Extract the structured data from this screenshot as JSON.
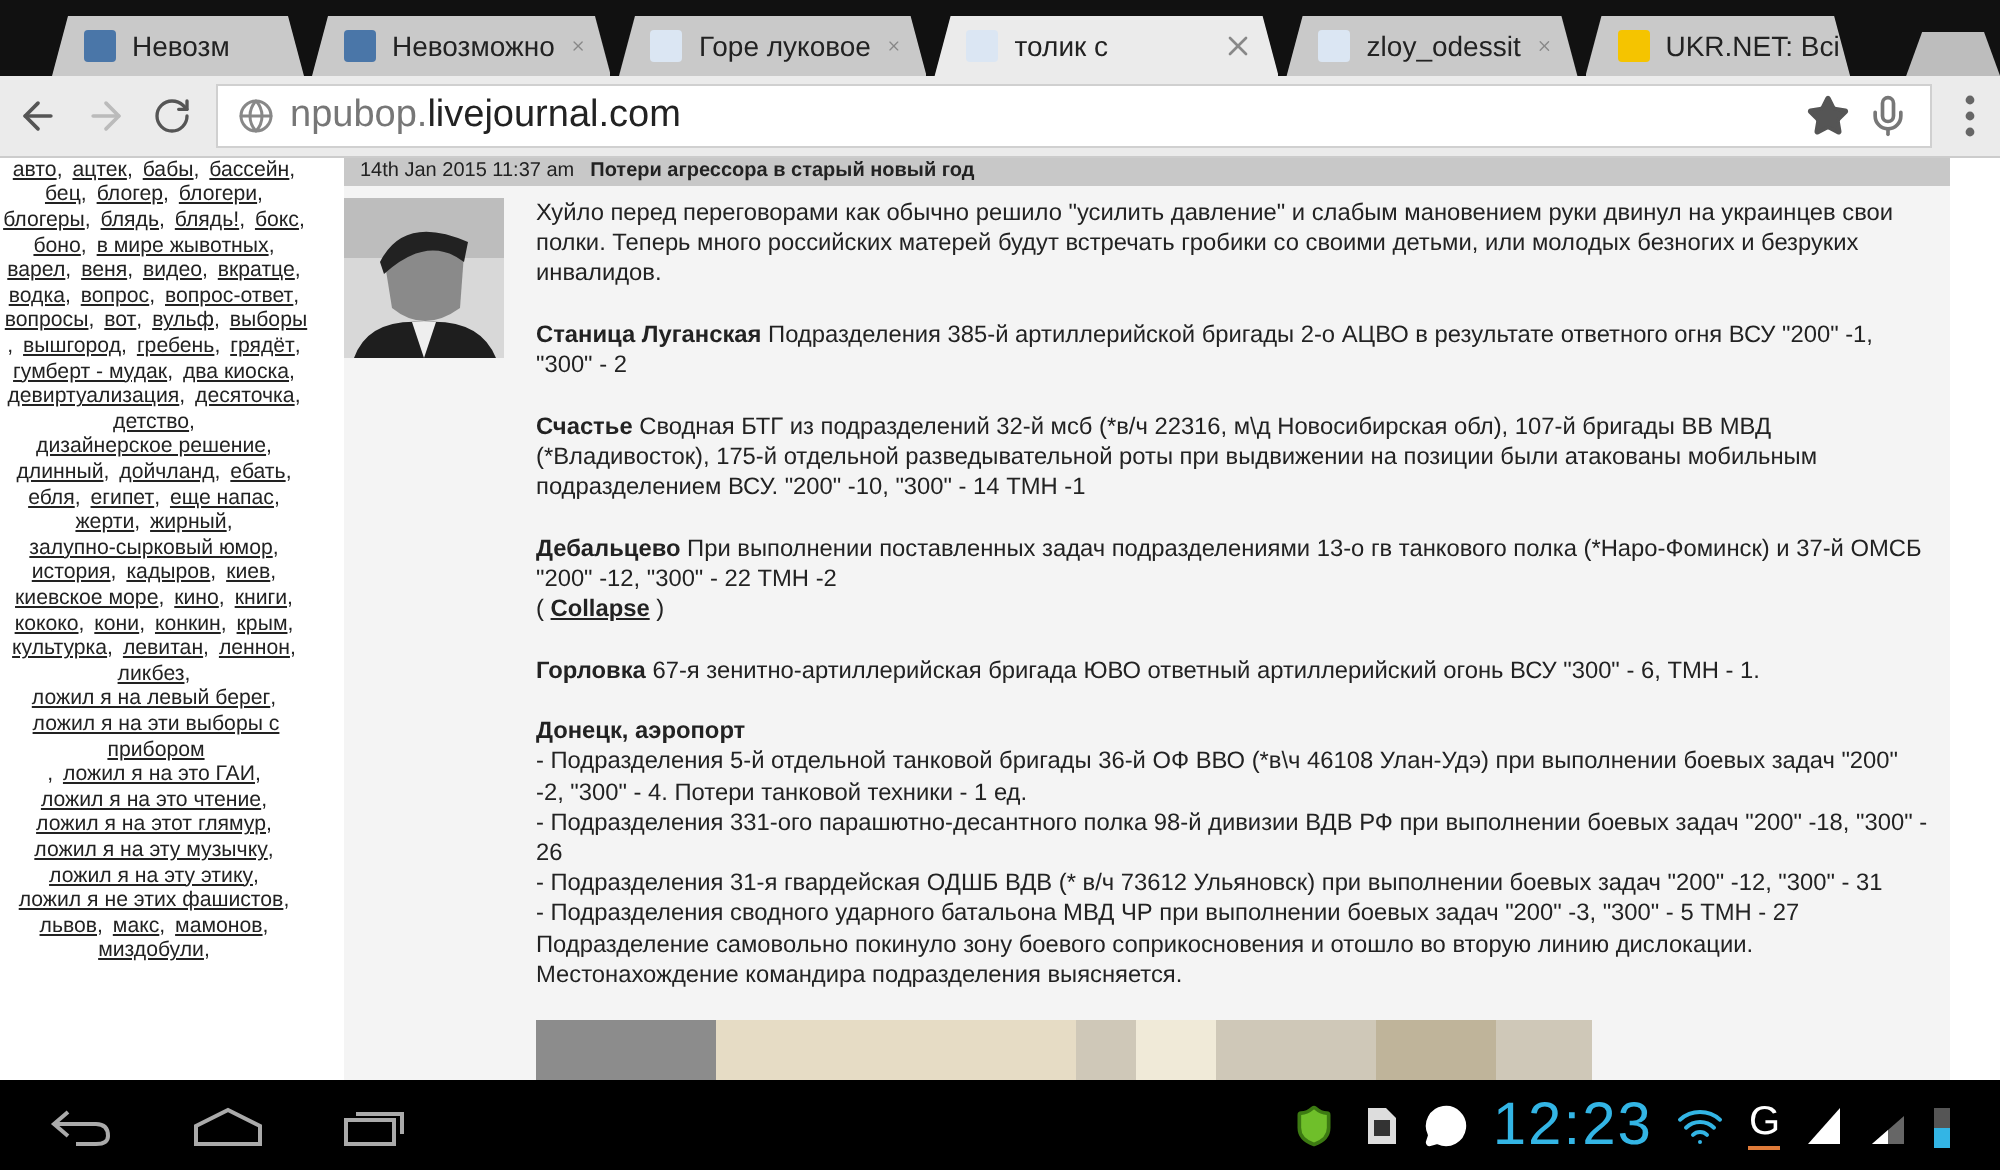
{
  "tabs": [
    {
      "title": "Невозм",
      "kind": "square",
      "selected": false,
      "closable": false
    },
    {
      "title": "Невозможно",
      "kind": "square",
      "selected": false,
      "closable": true
    },
    {
      "title": "Горе луковое",
      "kind": "person",
      "selected": false,
      "closable": true
    },
    {
      "title": "толик с",
      "kind": "person",
      "selected": true,
      "closable": true
    },
    {
      "title": "zloy_odessit",
      "kind": "person",
      "selected": false,
      "closable": true
    },
    {
      "title": "UKR.NET: Всі",
      "kind": "logo",
      "selected": false,
      "closable": false
    }
  ],
  "toolbar": {
    "forward_disabled": true,
    "url_prefix": "npubop.",
    "url_domain": "livejournal.com"
  },
  "tag_separator": ",",
  "tags": [
    "авто",
    "ацтек",
    "бабы",
    "бассейн",
    "бец",
    "блогер",
    "блогери",
    "блогеры",
    "блядь",
    "блядь!",
    "бокс",
    "боно",
    "в мире жывотных",
    "варел",
    "веня",
    "видео",
    "вкратце",
    "водка",
    "вопрос",
    "вопрос-ответ",
    "вопросы",
    "вот",
    "вульф",
    "выборы",
    "вышгород",
    "гребень",
    "грядёт",
    "гумберт - мудак",
    "два киоска",
    "девиртуализация",
    "десяточка",
    "детство",
    "дизайнерское решение",
    "длинный",
    "дойчланд",
    "ебать",
    "ебля",
    "египет",
    "еще напас",
    "жерти",
    "жирный",
    "залупно-сырковый юмор",
    "история",
    "кадыров",
    "киев",
    "киевское море",
    "кино",
    "книги",
    "кококо",
    "кони",
    "конкин",
    "крым",
    "культурка",
    "левитан",
    "леннон",
    "ликбез",
    "ложил я на левый берег",
    "ложил я на эти выборы с прибором",
    "ложил я на это ГАИ",
    "ложил я на это чтение",
    "ложил я на этот глямур",
    "ложил я на эту музычку",
    "ложил я на эту этику",
    "ложил я не этих фашистов",
    "львов",
    "макс",
    "мамонов",
    "миздобули"
  ],
  "post": {
    "date": "14th Jan 2015 11:37 am",
    "title": "Потери агрессора в старый новый год",
    "blocks": [
      {
        "kind": "text",
        "lines": [
          "Хуйло перед переговорами как обычно решило \"усилить давление\" и слабым мановением руки двинул на украинцев свои полки. Теперь много российских матерей будут встречать гробики со своими детьми, или молодых безногих и безруких инвалидов."
        ]
      },
      {
        "kind": "text",
        "lines": [
          "**Станица Луганская** Подразделения 385-й артиллерийской бригады 2-о АЦВО в результате ответного огня ВСУ \"200\" -1, \"300\" - 2"
        ]
      },
      {
        "kind": "text",
        "lines": [
          "**Счастье** Сводная БТГ из подразделений 32-й мсб (*в/ч 22316, м\\д Новосибирская обл), 107-й бригады ВВ МВД (*Владивосток), 175-й отдельной разведывательной роты при выдвижении на позиции были атакованы мобильным подразделением ВСУ. \"200\" -10, \"300\" - 14 ТМН -1"
        ]
      },
      {
        "kind": "collapse",
        "lines": [
          "**Дебальцево** При выполнении поставленных задач подразделениями 13-о гв танкового полка (*Наро-Фоминск) и 37-й ОМСБ \"200\" -12, \"300\" - 22 ТМН -2"
        ],
        "open": "(",
        "link": "Collapse",
        "close": ")"
      },
      {
        "kind": "text",
        "lines": [
          "**Горловка** 67-я зенитно-артиллерийская бригада ЮВО ответный артиллерийский огонь ВСУ \"300\" - 6, ТМН - 1."
        ]
      },
      {
        "kind": "text",
        "lines": [
          "**Донецк, аэропорт**",
          "- Подразделения 5-й отдельной танковой бригады 36-й ОФ ВВО (*в\\ч 46108 Улан-Удэ) при выполнении боевых задач \"200\" -2, \"300\" - 4. Потери танковой техники - 1 ед.",
          "- Подразделения 331-ого парашютно-десантного полка 98-й дивизии ВДВ РФ при выполнении боевых задач \"200\" -18, \"300\" - 26",
          "- Подразделения 31-я гвардейская ОДШБ ВДВ (* в/ч 73612 Ульяновск) при выполнении боевых задач \"200\" -12, \"300\" - 31",
          "- Подразделения сводного ударного батальона МВД ЧР при выполнении боевых задач \"200\" -3, \"300\" - 5 ТМН - 27",
          "Подразделение самовольно покинуло зону боевого соприкосновения и отошло во вторую линию дислокации.",
          "Местонахождение командира подразделения выясняется."
        ]
      },
      {
        "kind": "picture"
      }
    ]
  },
  "status": {
    "time": "12:23",
    "network": "G"
  }
}
